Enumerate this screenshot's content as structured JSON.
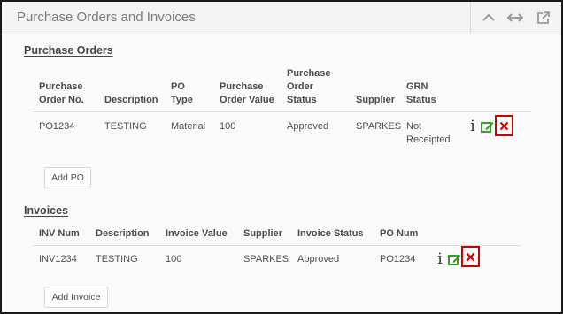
{
  "panel": {
    "title": "Purchase Orders and Invoices",
    "tools": [
      "collapse-icon",
      "expand-horizontal-icon",
      "external-link-icon"
    ]
  },
  "purchase_orders": {
    "section_title": "Purchase Orders",
    "headers": {
      "po_no": [
        "Purchase",
        "Order No."
      ],
      "description": "Description",
      "po_type": [
        "PO",
        "Type"
      ],
      "po_value": [
        "Purchase",
        "Order Value"
      ],
      "po_status": [
        "Purchase",
        "Order",
        "Status"
      ],
      "supplier": "Supplier",
      "grn_status": [
        "GRN",
        "Status"
      ]
    },
    "rows": [
      {
        "po_no": "PO1234",
        "description": "TESTING",
        "po_type": "Material",
        "po_value": "100",
        "po_status": "Approved",
        "supplier": "SPARKES",
        "grn_status": [
          "Not",
          "Receipted"
        ]
      }
    ],
    "add_button": "Add PO"
  },
  "invoices": {
    "section_title": "Invoices",
    "headers": {
      "inv_num": "INV Num",
      "description": "Description",
      "invoice_value": "Invoice Value",
      "supplier": "Supplier",
      "invoice_status": "Invoice Status",
      "po_num": "PO Num"
    },
    "rows": [
      {
        "inv_num": "INV1234",
        "description": "TESTING",
        "invoice_value": "100",
        "supplier": "SPARKES",
        "invoice_status": "Approved",
        "po_num": "PO1234"
      }
    ],
    "add_button": "Add Invoice"
  },
  "actions": {
    "info": "i",
    "edit": "edit-icon",
    "delete": "delete-icon"
  },
  "colors": {
    "edit": "#3a9a2a",
    "delete": "#cc0000"
  }
}
